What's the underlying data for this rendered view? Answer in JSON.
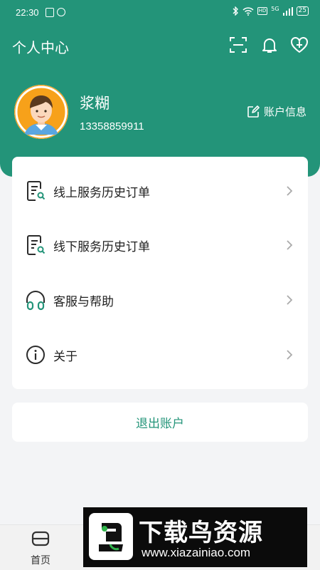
{
  "status_bar": {
    "time": "22:30",
    "network": "5G",
    "battery": "25"
  },
  "header": {
    "title": "个人中心",
    "icons": [
      "scan-icon",
      "bell-icon",
      "heart-add-icon"
    ]
  },
  "profile": {
    "name": "浆糊",
    "phone": "13358859911",
    "account_info_label": "账户信息"
  },
  "menu": {
    "items": [
      {
        "label": "线上服务历史订单",
        "icon": "document-search-icon"
      },
      {
        "label": "线下服务历史订单",
        "icon": "document-search-icon"
      },
      {
        "label": "客服与帮助",
        "icon": "headset-icon"
      },
      {
        "label": "关于",
        "icon": "info-icon"
      }
    ]
  },
  "logout_label": "退出账户",
  "tabbar": {
    "home_label": "首页"
  },
  "watermark": {
    "title": "下载鸟资源",
    "url": "www.xiazainiao.com"
  },
  "colors": {
    "brand": "#239479",
    "background": "#f3f4f6"
  }
}
